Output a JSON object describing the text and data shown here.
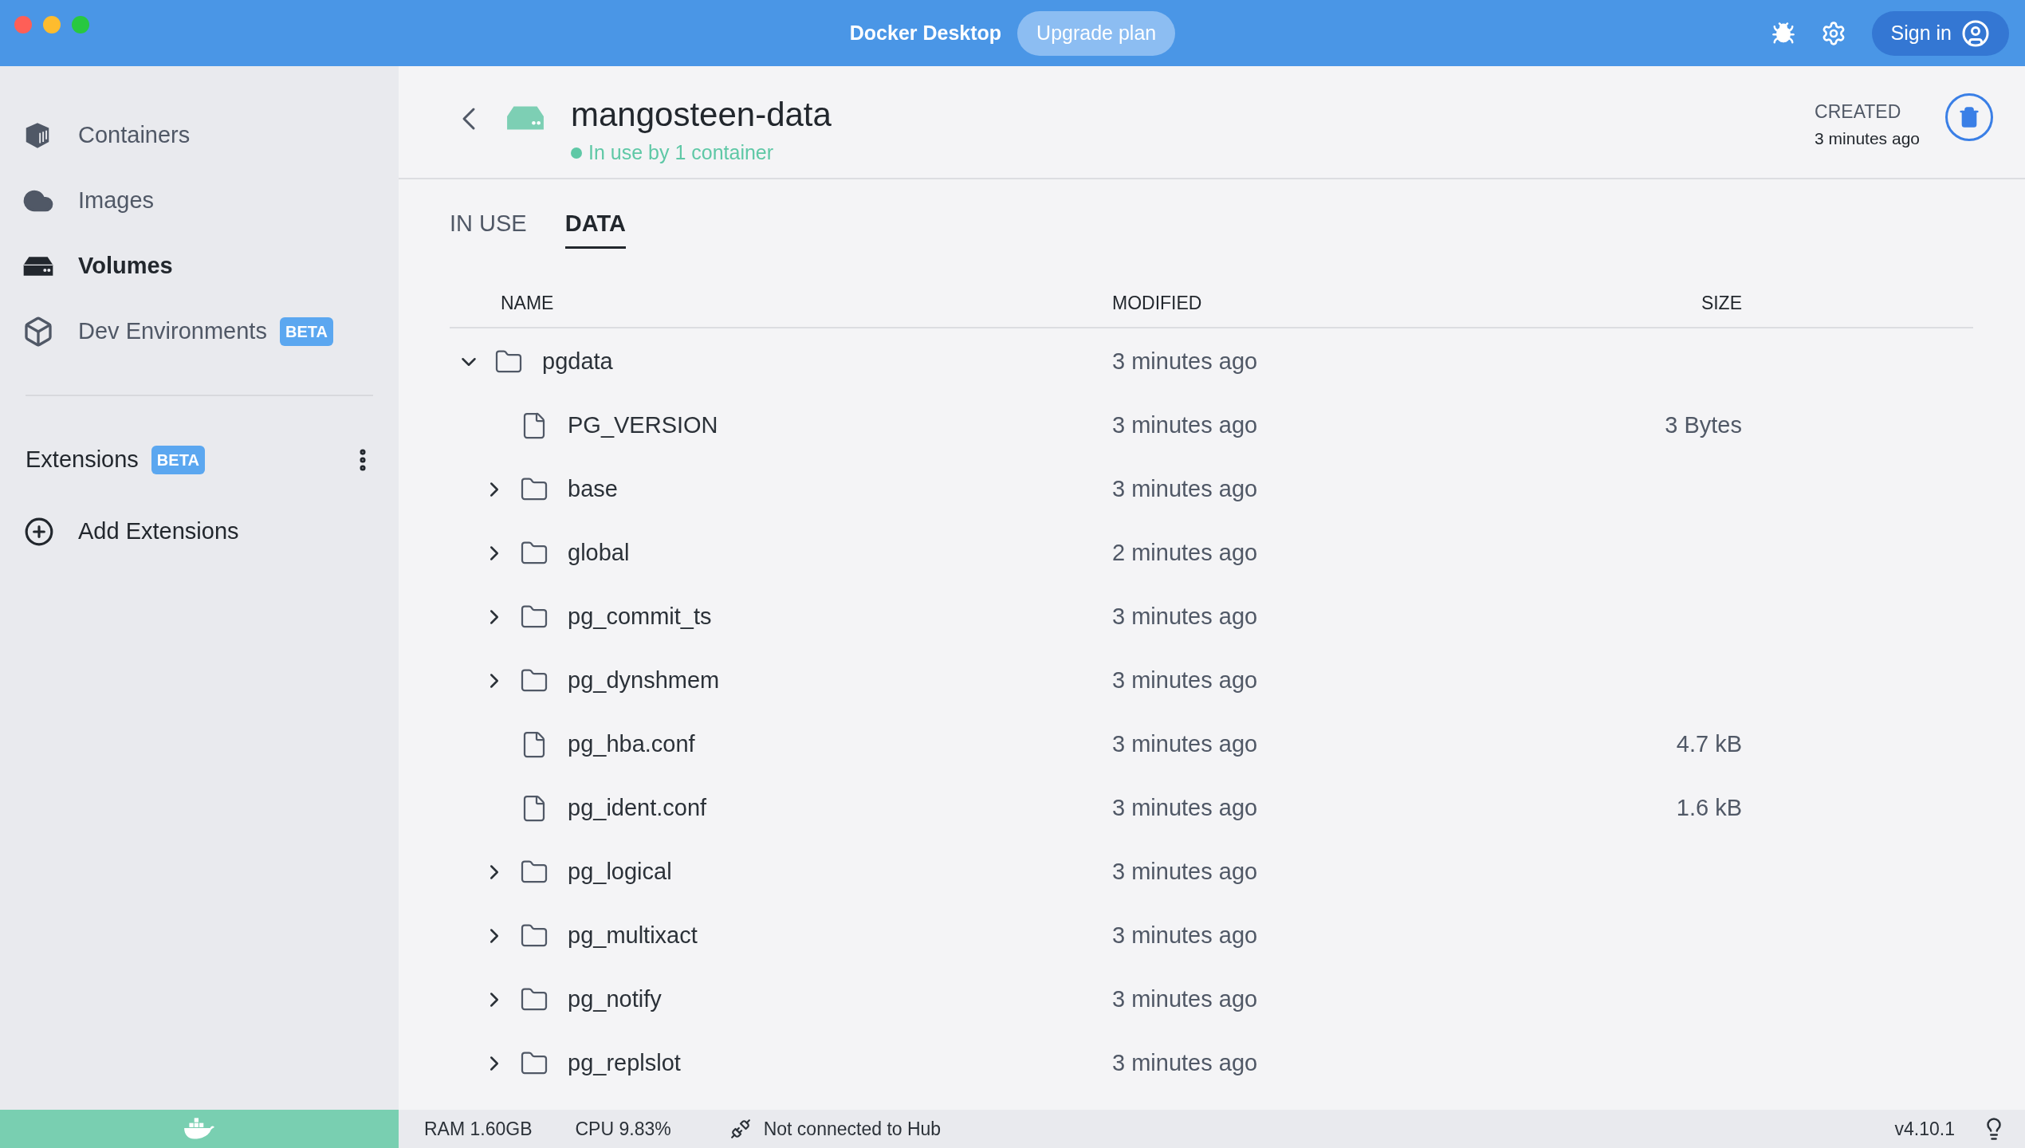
{
  "window": {
    "title": "Docker Desktop",
    "upgrade_button": "Upgrade plan",
    "sign_in": "Sign in"
  },
  "sidebar": {
    "items": [
      {
        "label": "Containers",
        "kind": "containers",
        "selected": false
      },
      {
        "label": "Images",
        "kind": "images",
        "selected": false
      },
      {
        "label": "Volumes",
        "kind": "volumes",
        "selected": true
      },
      {
        "label": "Dev Environments",
        "kind": "dev",
        "selected": false,
        "badge": "BETA"
      }
    ],
    "extensions": {
      "label": "Extensions",
      "badge": "BETA",
      "add": "Add Extensions"
    }
  },
  "volume": {
    "name": "mangosteen-data",
    "status": "In use by 1 container",
    "created_label": "CREATED",
    "created": "3 minutes ago"
  },
  "tabs": [
    {
      "label": "IN USE",
      "selected": false
    },
    {
      "label": "DATA",
      "selected": true
    }
  ],
  "table": {
    "columns": [
      "NAME",
      "MODIFIED",
      "SIZE"
    ],
    "rows": [
      {
        "name": "pgdata",
        "kind": "folder",
        "expanded": true,
        "modified": "3 minutes ago",
        "children": [
          {
            "name": "PG_VERSION",
            "kind": "file",
            "modified": "3 minutes ago",
            "size": "3 Bytes"
          },
          {
            "name": "base",
            "kind": "folder",
            "expanded": false,
            "modified": "3 minutes ago"
          },
          {
            "name": "global",
            "kind": "folder",
            "expanded": false,
            "modified": "2 minutes ago"
          },
          {
            "name": "pg_commit_ts",
            "kind": "folder",
            "expanded": false,
            "modified": "3 minutes ago"
          },
          {
            "name": "pg_dynshmem",
            "kind": "folder",
            "expanded": false,
            "modified": "3 minutes ago"
          },
          {
            "name": "pg_hba.conf",
            "kind": "file",
            "modified": "3 minutes ago",
            "size": "4.7 kB"
          },
          {
            "name": "pg_ident.conf",
            "kind": "file",
            "modified": "3 minutes ago",
            "size": "1.6 kB"
          },
          {
            "name": "pg_logical",
            "kind": "folder",
            "expanded": false,
            "modified": "3 minutes ago"
          },
          {
            "name": "pg_multixact",
            "kind": "folder",
            "expanded": false,
            "modified": "3 minutes ago"
          },
          {
            "name": "pg_notify",
            "kind": "folder",
            "expanded": false,
            "modified": "3 minutes ago"
          },
          {
            "name": "pg_replslot",
            "kind": "folder",
            "expanded": false,
            "modified": "3 minutes ago"
          }
        ]
      }
    ]
  },
  "status_bar": {
    "ram": "RAM 1.60GB",
    "cpu": "CPU 9.83%",
    "hub": "Not connected to Hub",
    "version": "v4.10.1"
  }
}
